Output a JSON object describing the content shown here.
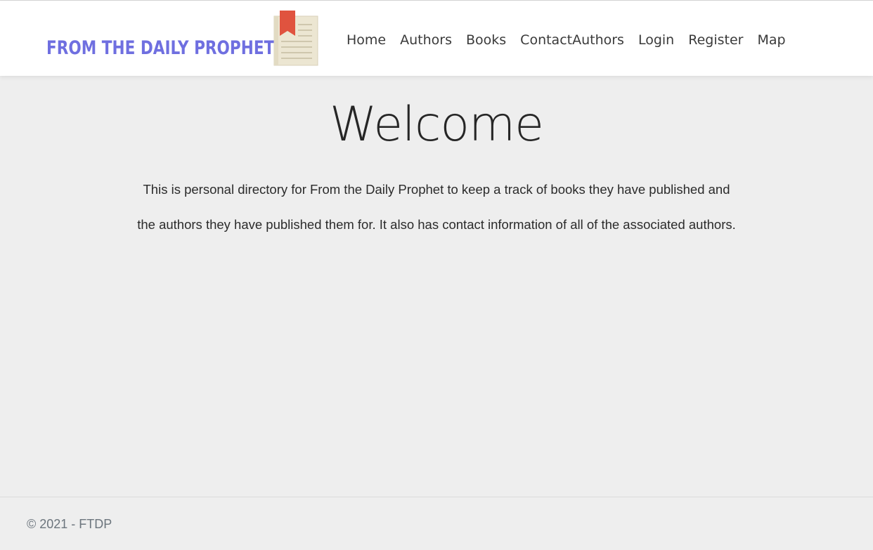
{
  "header": {
    "brand_text": "FROM THE DAILY PROPHET",
    "brand_icon": "book-bookmark-icon",
    "nav": [
      {
        "label": "Home"
      },
      {
        "label": "Authors"
      },
      {
        "label": "Books"
      },
      {
        "label": "ContactAuthors"
      },
      {
        "label": "Login"
      },
      {
        "label": "Register"
      },
      {
        "label": "Map"
      }
    ]
  },
  "main": {
    "title": "Welcome",
    "description": "This is personal directory for From the Daily Prophet to keep a track of books they have published and the authors they have published them for. It also has contact information of all of the associated authors."
  },
  "footer": {
    "copyright": "© 2021 - FTDP"
  },
  "colors": {
    "brand": "#6f6fe0",
    "background": "#eeeeee",
    "navbar": "#ffffff",
    "bookmark": "#e0533f",
    "book_page": "#ece6d2"
  }
}
